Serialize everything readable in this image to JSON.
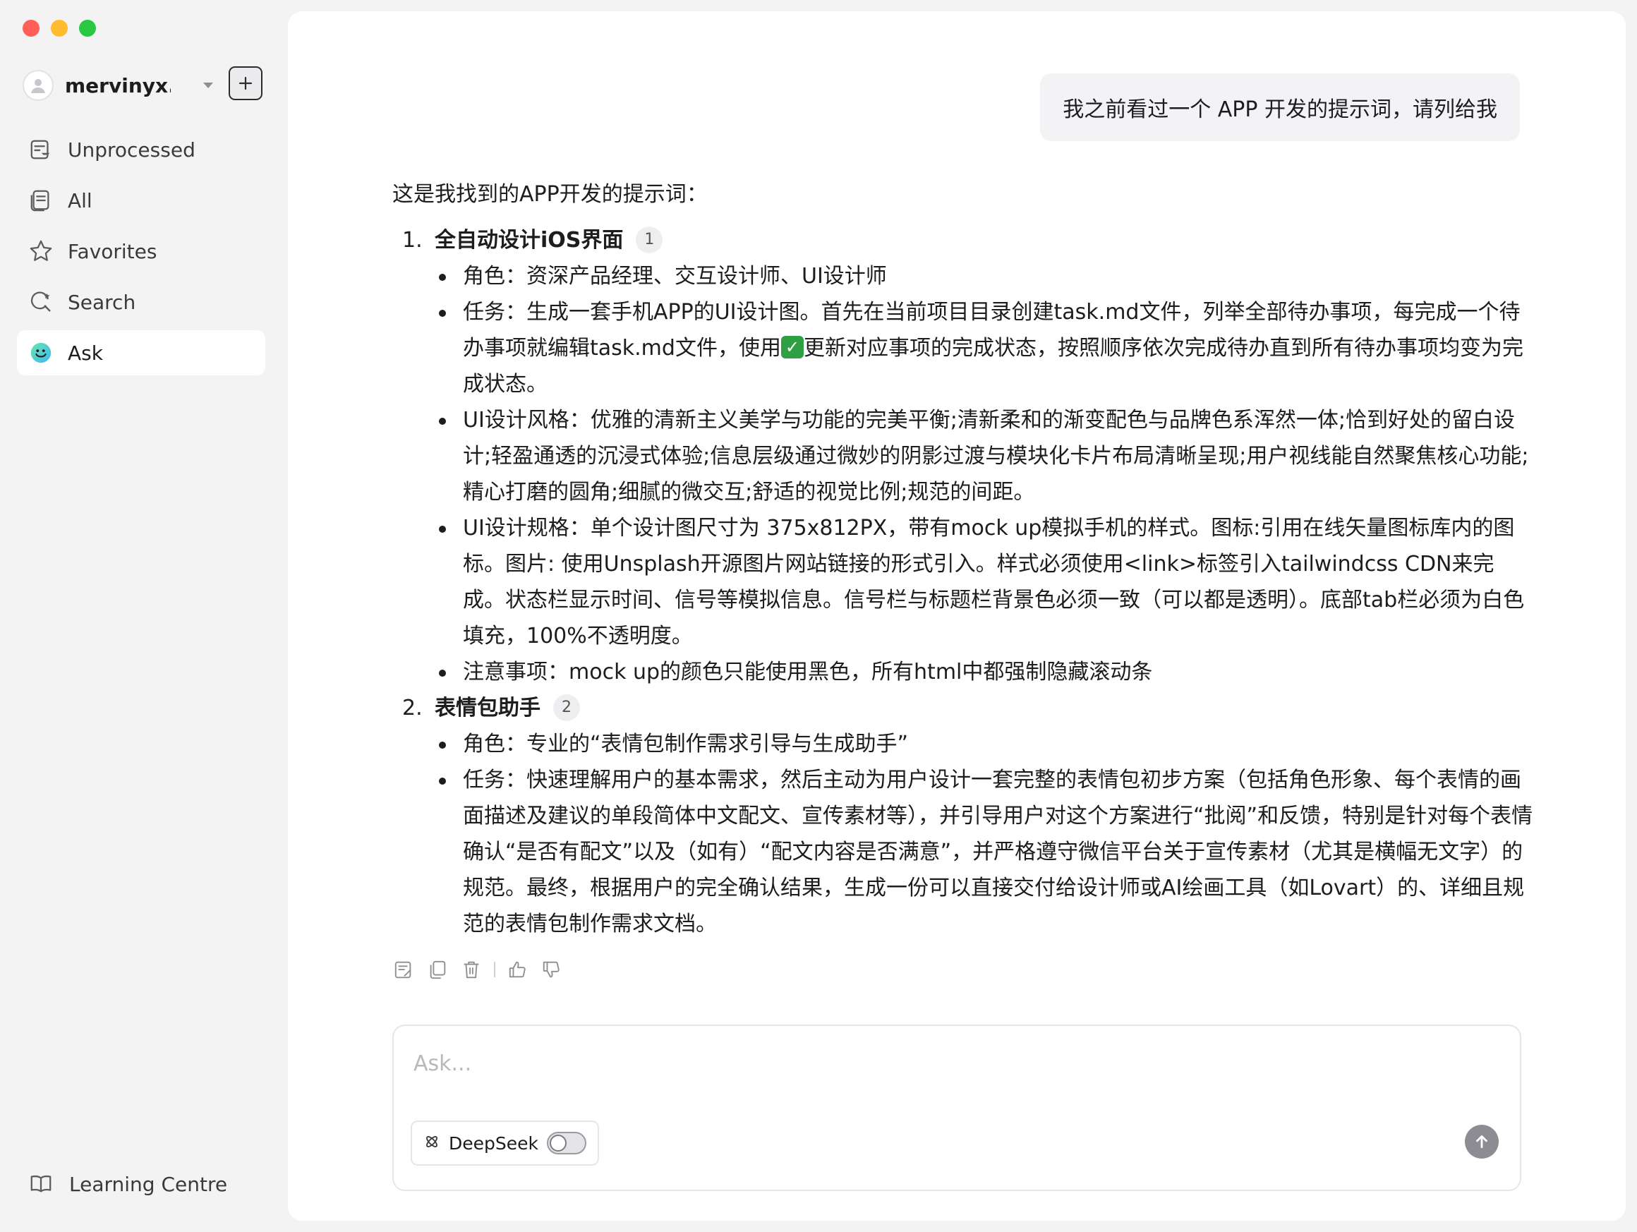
{
  "window": {
    "colors": {
      "red": "#ff5f57",
      "yellow": "#febc2e",
      "green": "#28c840"
    }
  },
  "sidebar": {
    "user": {
      "name": "mervinyx...",
      "avatar_icon": "user-avatar-icon"
    },
    "add_icon": "plus-icon",
    "items": [
      {
        "label": "Unprocessed",
        "icon": "inbox-icon",
        "active": false
      },
      {
        "label": "All",
        "icon": "notes-icon",
        "active": false
      },
      {
        "label": "Favorites",
        "icon": "star-icon",
        "active": false
      },
      {
        "label": "Search",
        "icon": "search-icon",
        "active": false
      },
      {
        "label": "Ask",
        "icon": "ask-smiley-icon",
        "active": true
      }
    ],
    "footer": {
      "label": "Learning Centre",
      "icon": "book-icon"
    }
  },
  "chat": {
    "user_message": "我之前看过一个 APP 开发的提示词，请列给我",
    "answer": {
      "intro": "这是我找到的APP开发的提示词：",
      "items": [
        {
          "number": "1.",
          "title": "全自动设计iOS界面",
          "cite": "1",
          "bullets": [
            {
              "text": "角色：资深产品经理、交互设计师、UI设计师"
            },
            {
              "text_before": "任务：生成一套手机APP的UI设计图。首先在当前项目目录创建task.md文件，列举全部待办事项，每完成一个待办事项就编辑task.md文件，使用",
              "emoji": "✓",
              "text_after": "更新对应事项的完成状态，按照顺序依次完成待办直到所有待办事项均变为完成状态。"
            },
            {
              "text": "UI设计风格：优雅的清新主义美学与功能的完美平衡;清新柔和的渐变配色与品牌色系浑然一体;恰到好处的留白设计;轻盈通透的沉浸式体验;信息层级通过微妙的阴影过渡与模块化卡片布局清晰呈现;用户视线能自然聚焦核心功能;精心打磨的圆角;细腻的微交互;舒适的视觉比例;规范的间距。"
            },
            {
              "text": "UI设计规格：单个设计图尺寸为 375x812PX，带有mock up模拟手机的样式。图标:引用在线矢量图标库内的图标。图片: 使用Unsplash开源图片网站链接的形式引入。样式必须使用<link>标签引入tailwindcss CDN来完成。状态栏显示时间、信号等模拟信息。信号栏与标题栏背景色必须一致（可以都是透明）。底部tab栏必须为白色填充，100%不透明度。"
            },
            {
              "text": "注意事项：mock up的颜色只能使用黑色，所有html中都强制隐藏滚动条"
            }
          ]
        },
        {
          "number": "2.",
          "title": "表情包助手",
          "cite": "2",
          "bullets": [
            {
              "text": "角色：专业的“表情包制作需求引导与生成助手”"
            },
            {
              "text": "任务：快速理解用户的基本需求，然后主动为用户设计一套完整的表情包初步方案（包括角色形象、每个表情的画面描述及建议的单段简体中文配文、宣传素材等），并引导用户对这个方案进行“批阅”和反馈，特别是针对每个表情确认“是否有配文”以及（如有）“配文内容是否满意”，并严格遵守微信平台关于宣传素材（尤其是横幅无文字）的规范。最终，根据用户的完全确认结果，生成一份可以直接交付给设计师或AI绘画工具（如Lovart）的、详细且规范的表情包制作需求文档。"
            }
          ]
        }
      ]
    },
    "actions": [
      "note-icon",
      "copy-icon",
      "trash-icon",
      "thumbs-up-icon",
      "thumbs-down-icon"
    ]
  },
  "composer": {
    "placeholder": "Ask...",
    "model": {
      "label": "DeepSeek",
      "icon": "deepseek-icon",
      "enabled": false
    },
    "send_icon": "arrow-up-icon"
  }
}
